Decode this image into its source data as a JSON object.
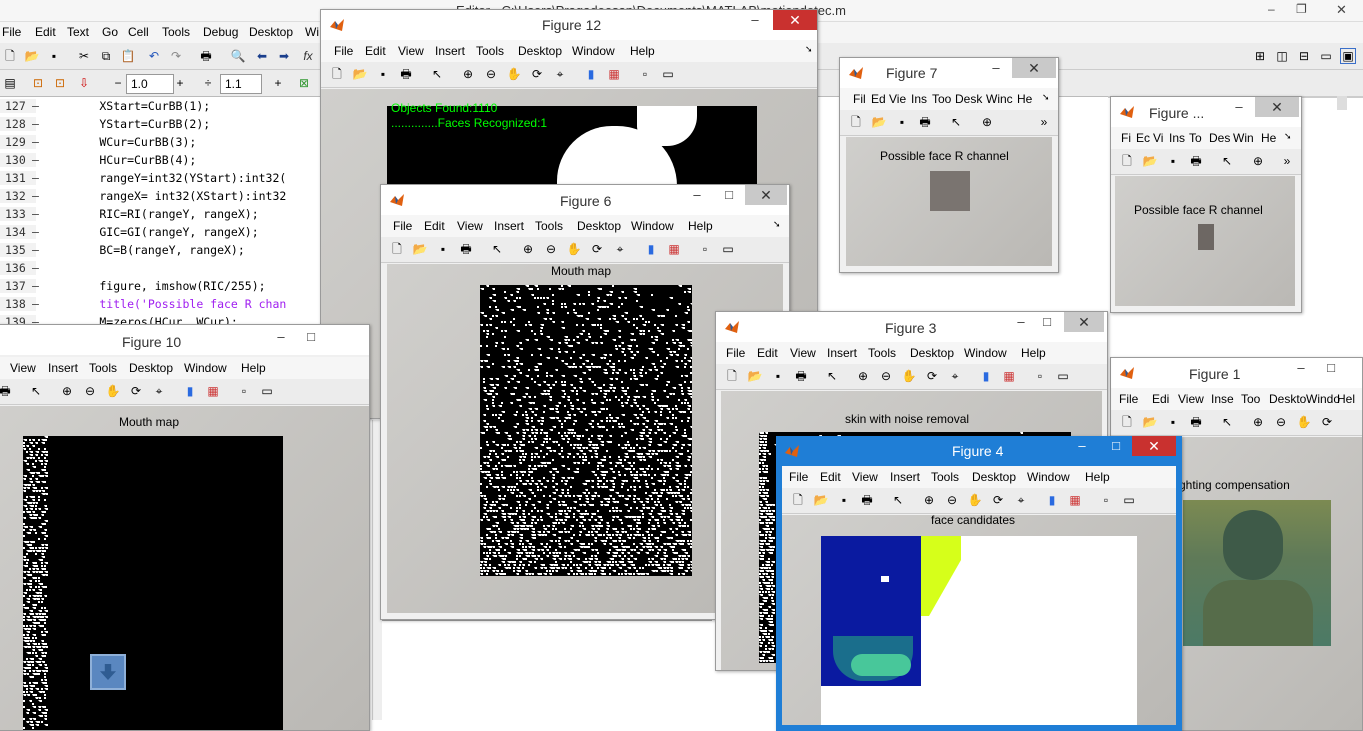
{
  "editor": {
    "title": "Editor - C:\\Users\\Pragadeesan\\Documents\\MATLAB\\motiondetec.m",
    "menu": [
      "File",
      "Edit",
      "Text",
      "Go",
      "Cell",
      "Tools",
      "Debug",
      "Desktop",
      "Wi"
    ],
    "zoom_minus": "−",
    "spacing_value": "1.0",
    "zoom_plus": "+",
    "divide_sym": "÷",
    "scale_value": "1.1",
    "fx": "fx",
    "lines": [
      {
        "n": "127",
        "code": "        XStart=CurBB(1);"
      },
      {
        "n": "128",
        "code": "        YStart=CurBB(2);"
      },
      {
        "n": "129",
        "code": "        WCur=CurBB(3);"
      },
      {
        "n": "130",
        "code": "        HCur=CurBB(4);"
      },
      {
        "n": "131",
        "code": "        rangeY=int32(YStart):int32("
      },
      {
        "n": "132",
        "code": "        rangeX= int32(XStart):int32"
      },
      {
        "n": "133",
        "code": "        RIC=RI(rangeY, rangeX);"
      },
      {
        "n": "134",
        "code": "        GIC=GI(rangeY, rangeX);"
      },
      {
        "n": "135",
        "code": "        BC=B(rangeY, rangeX);"
      },
      {
        "n": "136",
        "code": ""
      },
      {
        "n": "137",
        "code": "        figure, imshow(RIC/255);"
      },
      {
        "n": "138",
        "code": "        title('Possible face R chan",
        "str": true
      },
      {
        "n": "139",
        "code": "        M=zeros(HCur, WCur);"
      }
    ]
  },
  "fig12": {
    "title": "Figure 12",
    "menu": [
      "File",
      "Edit",
      "View",
      "Insert",
      "Tools",
      "Desktop",
      "Window",
      "Help"
    ],
    "text1": "Objects Found:1110",
    "text2": "..............Faces Recognized:1"
  },
  "fig6": {
    "title": "Figure 6",
    "menu": [
      "File",
      "Edit",
      "View",
      "Insert",
      "Tools",
      "Desktop",
      "Window",
      "Help"
    ],
    "caption": "Mouth map"
  },
  "fig10": {
    "title": "Figure 10",
    "menu": [
      "View",
      "Insert",
      "Tools",
      "Desktop",
      "Window",
      "Help"
    ],
    "caption": "Mouth map"
  },
  "fig7": {
    "title": "Figure 7",
    "menu": [
      "Fil",
      "Ed",
      "Vie",
      "Ins",
      "Too",
      "Desk",
      "Winc",
      "He"
    ],
    "caption": "Possible face R channel"
  },
  "figX": {
    "title": "Figure ...",
    "menu": [
      "Fi",
      "Ec",
      "Vi",
      "Ins",
      "To",
      "Des",
      "Win",
      "He"
    ],
    "caption": "Possible face R channel"
  },
  "fig3": {
    "title": "Figure 3",
    "menu": [
      "File",
      "Edit",
      "View",
      "Insert",
      "Tools",
      "Desktop",
      "Window",
      "Help"
    ],
    "caption": "skin with noise removal"
  },
  "fig1": {
    "title": "Figure 1",
    "menu": [
      "File",
      "Edi",
      "View",
      "Inse",
      "Too",
      "Deskto",
      "Windo",
      "Hel"
    ],
    "caption": "ghting compensation"
  },
  "fig4": {
    "title": "Figure 4",
    "menu": [
      "File",
      "Edit",
      "View",
      "Insert",
      "Tools",
      "Desktop",
      "Window",
      "Help"
    ],
    "caption": "face candidates"
  },
  "colors": {
    "active_border": "#1f7ed6",
    "close": "#c9312f",
    "string": "#a020f0",
    "text_green": "#00ff00"
  }
}
